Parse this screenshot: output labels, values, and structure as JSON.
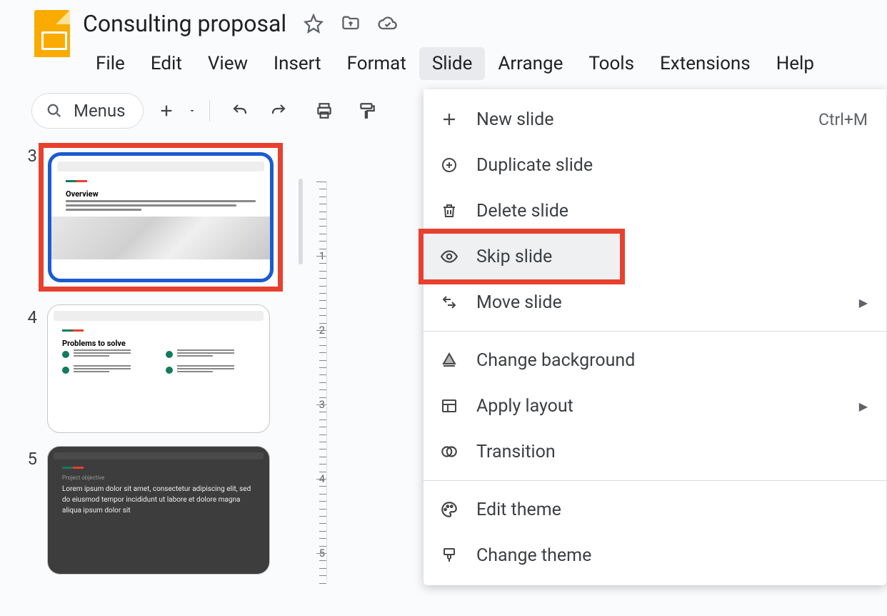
{
  "doc": {
    "title": "Consulting proposal"
  },
  "menubar": [
    "File",
    "Edit",
    "View",
    "Insert",
    "Format",
    "Slide",
    "Arrange",
    "Tools",
    "Extensions",
    "Help"
  ],
  "active_menu_index": 5,
  "toolbar": {
    "menus_label": "Menus"
  },
  "slides": [
    {
      "num": "3",
      "title": "Overview",
      "selected": true,
      "highlighted": true
    },
    {
      "num": "4",
      "title": "Problems to solve"
    },
    {
      "num": "5",
      "title_small": "Project objective",
      "body": "Lorem ipsum dolor sit amet, consectetur adipiscing elit, sed do eiusmod tempor incididunt ut labore et dolore magna aliqua ipsum dolor sit"
    }
  ],
  "dropdown": {
    "items": [
      {
        "icon": "plus",
        "label": "New slide",
        "shortcut": "Ctrl+M"
      },
      {
        "icon": "dup",
        "label": "Duplicate slide"
      },
      {
        "icon": "del",
        "label": "Delete slide"
      },
      {
        "icon": "eye",
        "label": "Skip slide",
        "hover": true,
        "highlighted": true
      },
      {
        "icon": "move",
        "label": "Move slide",
        "submenu": true
      },
      {
        "sep": true
      },
      {
        "icon": "bg",
        "label": "Change background"
      },
      {
        "icon": "layout",
        "label": "Apply layout",
        "submenu": true
      },
      {
        "icon": "trans",
        "label": "Transition"
      },
      {
        "sep": true
      },
      {
        "icon": "palette",
        "label": "Edit theme"
      },
      {
        "icon": "brush",
        "label": "Change theme"
      }
    ]
  },
  "ruler": {
    "ticks": [
      "1",
      "2",
      "3",
      "4",
      "5"
    ]
  }
}
